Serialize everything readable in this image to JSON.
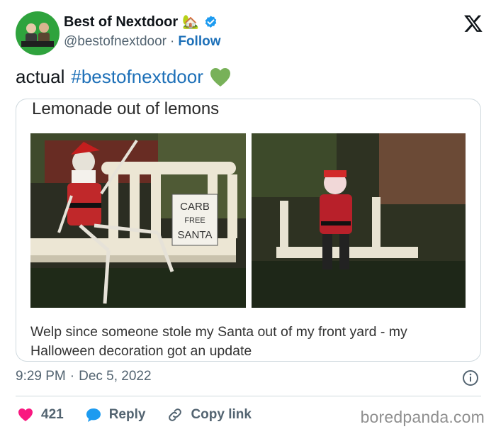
{
  "author": {
    "display_name": "Best of Nextdoor",
    "emoji": "🏡",
    "handle": "@bestofnextdoor",
    "separator": "·",
    "follow_label": "Follow"
  },
  "tweet": {
    "text_prefix": "actual",
    "hashtag": "#bestofnextdoor",
    "emoji": "green-heart"
  },
  "media": {
    "title": "Lemonade out of lemons",
    "sign_text": [
      "CARB",
      "FREE",
      "SANTA"
    ],
    "caption": "Welp since someone stole my Santa out of my front yard - my Halloween decoration got an update"
  },
  "meta": {
    "time": "9:29 PM",
    "separator": "·",
    "date": "Dec 5, 2022"
  },
  "actions": {
    "like_count": "421",
    "reply_label": "Reply",
    "copy_label": "Copy link"
  },
  "watermark": "boredpanda.com",
  "colors": {
    "link": "#1d70b8",
    "like": "#f91880",
    "verified": "#1d9bf0",
    "avatar_bg": "#2fa33d",
    "heart_emoji": "#78b159"
  },
  "icons": [
    "x-logo-icon",
    "verified-badge-icon",
    "house-emoji-icon",
    "green-heart-icon",
    "info-icon",
    "heart-icon",
    "reply-bubble-icon",
    "link-icon"
  ]
}
